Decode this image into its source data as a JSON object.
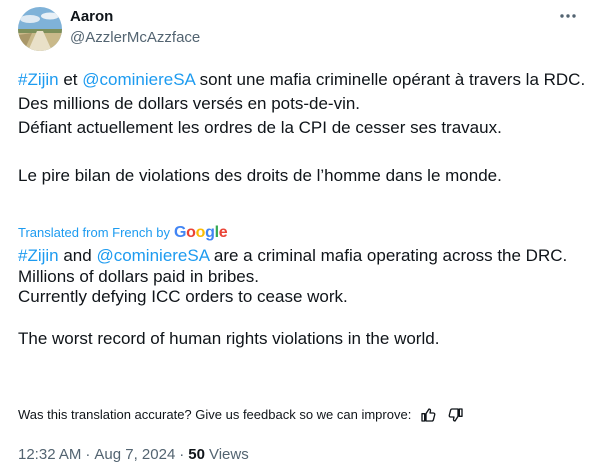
{
  "author": {
    "name": "Aaron",
    "handle": "@AzzlerMcAzzface"
  },
  "icons": {
    "more": "more-horizontal-icon",
    "thumbs_up": "thumbs-up-icon",
    "thumbs_down": "thumbs-down-icon",
    "avatar": "landscape-road-avatar"
  },
  "original": {
    "line1_hashtag": "#Zijin",
    "line1_mid": " et ",
    "line1_mention": "@cominiereSA",
    "line1_rest": " sont une mafia criminelle opérant à travers la RDC.",
    "line2": "Des millions de dollars versés en pots-de-vin.",
    "line3": "Défiant actuellement les ordres de la CPI de cesser ses travaux.",
    "line4": "Le pire bilan de violations des droits de l’homme dans le monde."
  },
  "translation_label": "Translated from French by",
  "google_logo": "Google",
  "translated": {
    "line1_hashtag": "#Zijin",
    "line1_mid": " and ",
    "line1_mention": "@cominiereSA",
    "line1_rest": " are a criminal mafia operating across the DRC.",
    "line2": "Millions of dollars paid in bribes.",
    "line3": "Currently defying ICC orders to cease work.",
    "line4": "The worst record of human rights violations in the world."
  },
  "feedback_prompt": "Was this translation accurate? Give us feedback so we can improve:",
  "meta": {
    "time": "12:32 AM",
    "sep1": "·",
    "date": "Aug 7, 2024",
    "sep2": "·",
    "views_count": "50",
    "views_label": "Views"
  },
  "colors": {
    "link": "#1d9bf0",
    "text": "#0f1419",
    "secondary": "#536471"
  }
}
